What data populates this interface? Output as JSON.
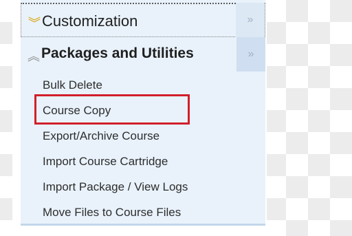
{
  "menu": {
    "customization": {
      "label": "Customization",
      "chevron_icon": "chevron-double-down-icon",
      "expand_glyph": "»",
      "chevron_glyph": "︾"
    },
    "packages": {
      "label": "Packages and Utilities",
      "chevron_icon": "chevron-double-up-icon",
      "expand_glyph": "»",
      "chevron_glyph": "︽",
      "items": [
        {
          "label": "Bulk Delete"
        },
        {
          "label": "Course Copy",
          "highlighted": true
        },
        {
          "label": "Export/Archive Course"
        },
        {
          "label": "Import Course Cartridge"
        },
        {
          "label": "Import Package / View Logs"
        },
        {
          "label": "Move Files to Course Files"
        }
      ]
    }
  },
  "colors": {
    "panel_bg": "#e9f2fb",
    "highlight": "#d11f2b",
    "chevron_down": "#d8a200",
    "chevron_up": "#8a8a8a",
    "text": "#2d2d2d"
  }
}
